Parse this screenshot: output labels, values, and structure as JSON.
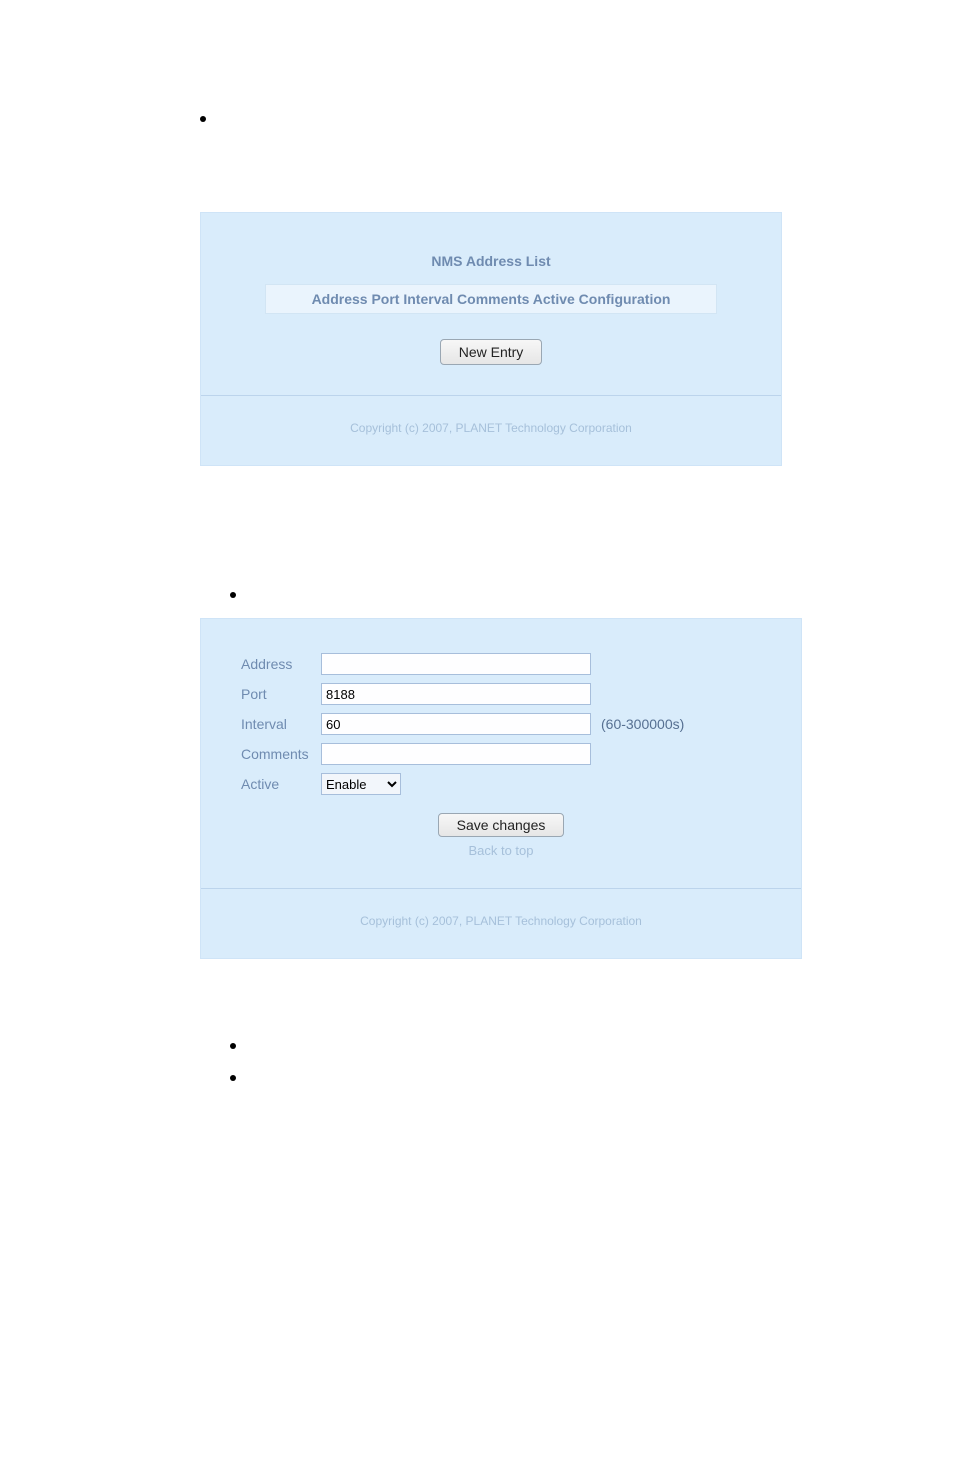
{
  "bullets": {
    "top": "",
    "middle": "",
    "lower1": "",
    "lower2": ""
  },
  "nms_panel": {
    "title": "NMS Address List",
    "headers_line": "Address Port Interval Comments Active Configuration",
    "new_entry_btn": "New Entry",
    "copyright": "Copyright (c) 2007, PLANET Technology Corporation"
  },
  "form": {
    "labels": {
      "address": "Address",
      "port": "Port",
      "interval": "Interval",
      "comments": "Comments",
      "active": "Active"
    },
    "values": {
      "address": "",
      "port": "8188",
      "interval": "60",
      "comments": ""
    },
    "interval_suffix": "(60-300000s)",
    "active_selected": "Enable",
    "save_btn": "Save changes",
    "back_link": "Back to top",
    "copyright": "Copyright (c) 2007, PLANET Technology Corporation"
  }
}
